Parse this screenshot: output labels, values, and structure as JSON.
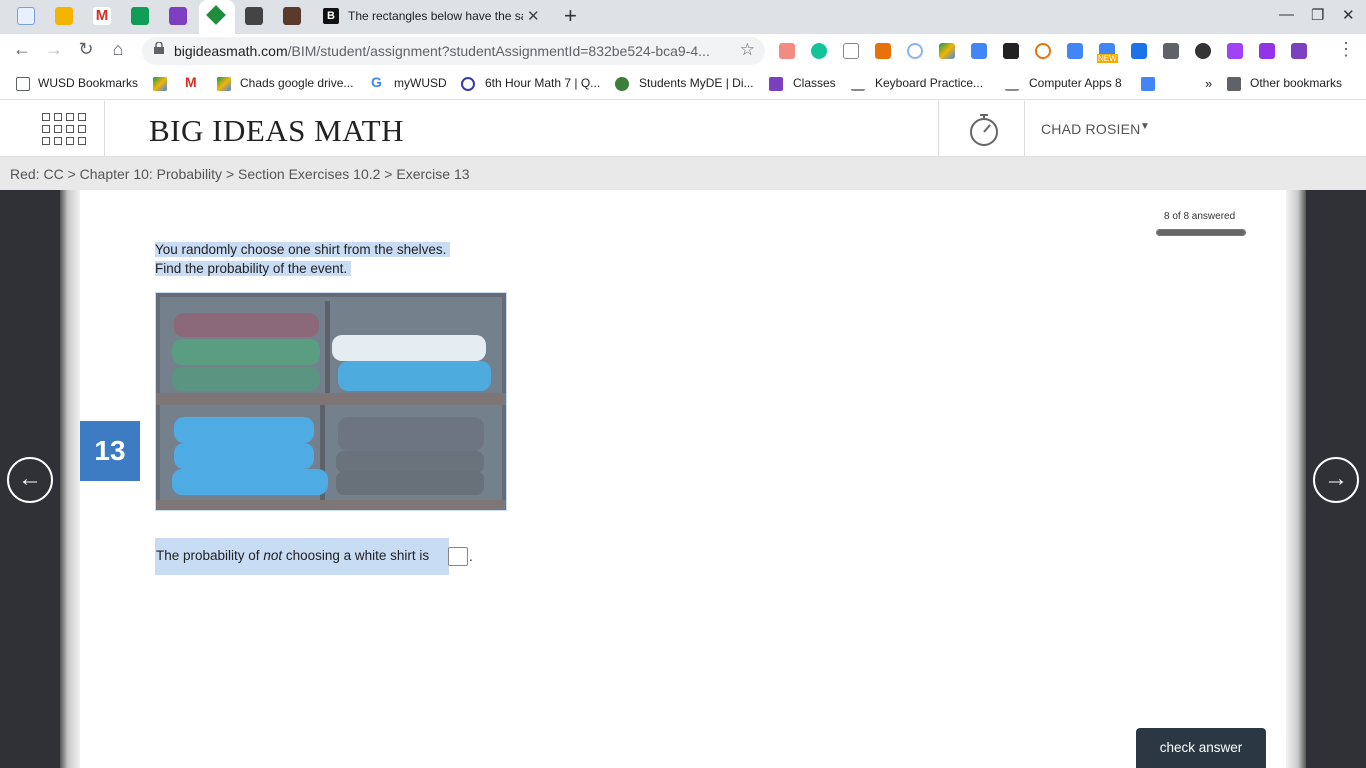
{
  "browser": {
    "active_tab_title": "The rectangles below have the sa",
    "url_host": "bigideasmath.com",
    "url_path": "/BIM/student/assignment?studentAssignmentId=832be524-bca9-4...",
    "ext_badge_new": "NEW"
  },
  "bookmarks": [
    "WUSD Bookmarks",
    "Chads google drive...",
    "myWUSD",
    "6th Hour Math 7 | Q...",
    "Students MyDE | Di...",
    "Classes",
    "Keyboard Practice...",
    "Computer Apps 8",
    "Other bookmarks"
  ],
  "header": {
    "logo": "BIG IDEAS MATH",
    "user": "CHAD ROSIEN"
  },
  "breadcrumb": "Red: CC > Chapter 10: Probability > Section Exercises 10.2 > Exercise 13",
  "progress": {
    "label": "8 of 8 answered",
    "fraction": 1.0
  },
  "question": {
    "number": "13",
    "line1": "You randomly choose one shirt from the shelves.",
    "line2": "Find the probability of the event.",
    "answer_prefix": "The probability of ",
    "answer_emph": "not",
    "answer_suffix": " choosing a white shirt is ",
    "answer_end": ".",
    "answer_value": ""
  },
  "nav": {
    "prev_arrow": "←",
    "next_arrow": "→"
  },
  "buttons": {
    "check_answer": "check answer"
  },
  "colors": {
    "accent": "#3d7cc3",
    "highlight": "#c8dcf3",
    "side_panel": "#2f3136",
    "button_dark": "#2b3742"
  }
}
